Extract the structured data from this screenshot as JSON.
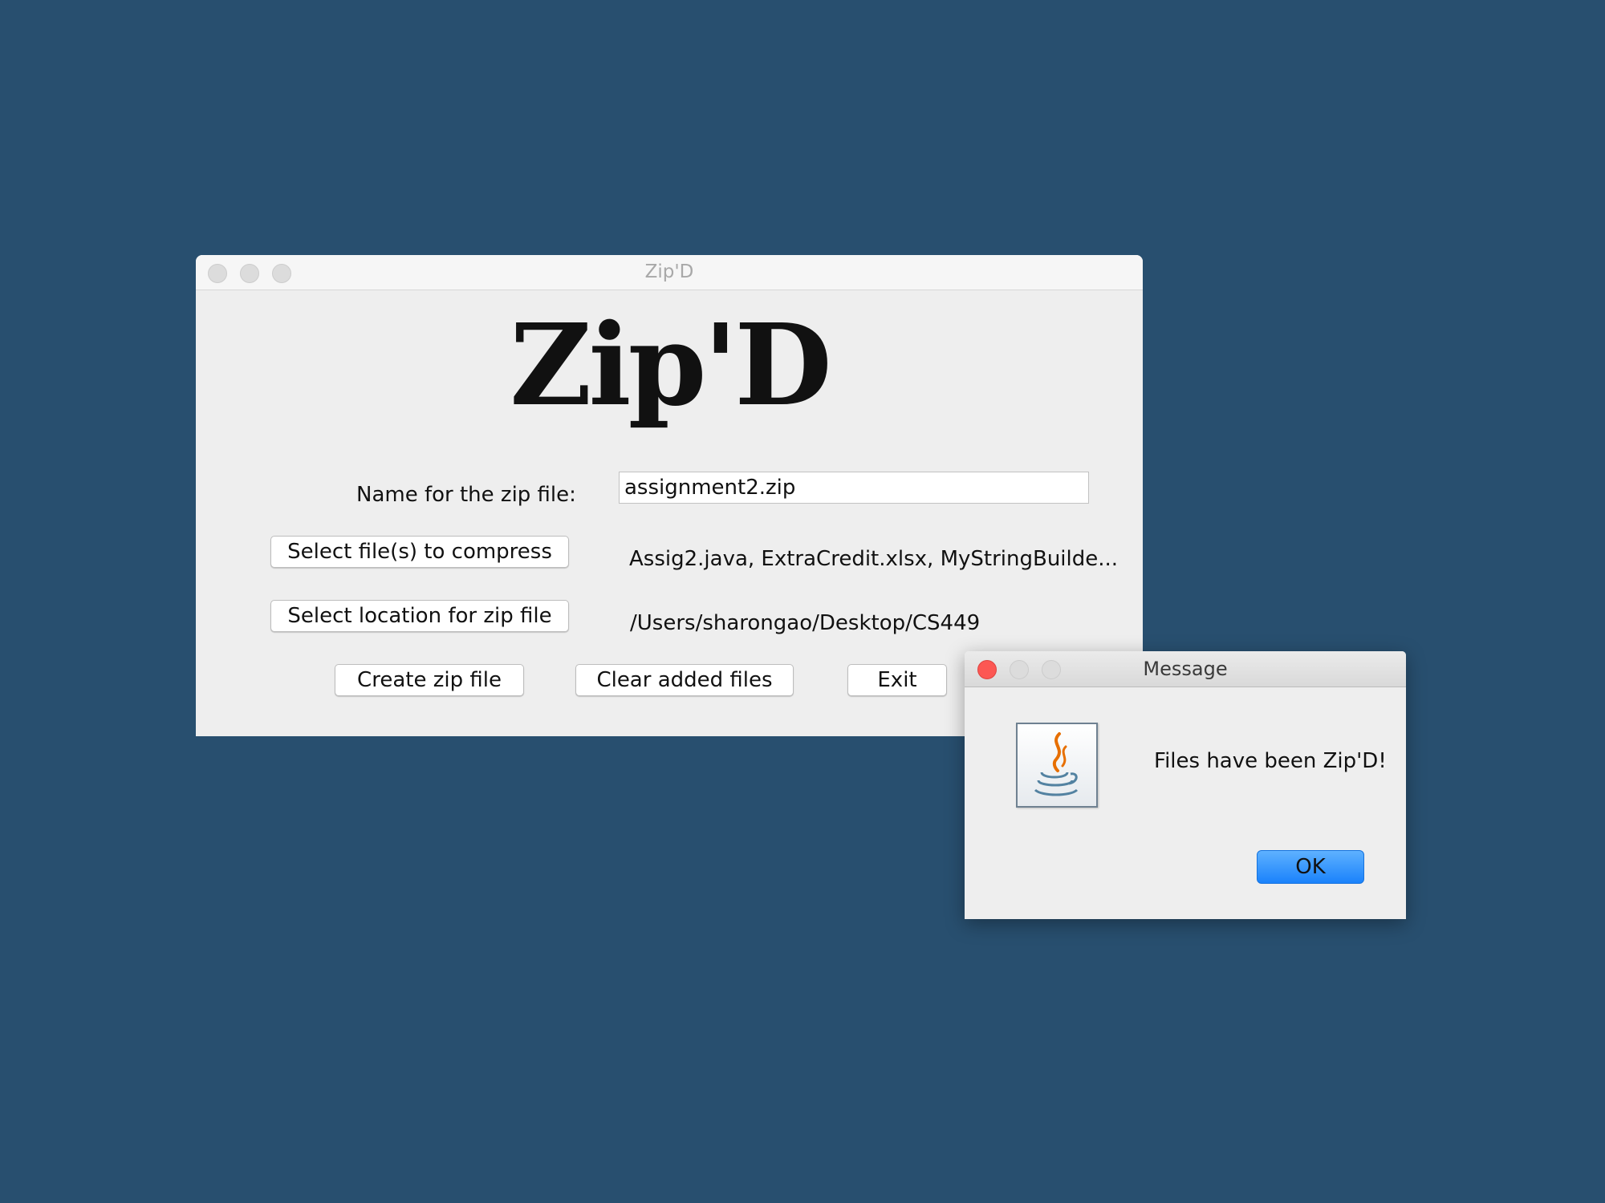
{
  "main_window": {
    "title": "Zip'D",
    "logo": "Zip'D",
    "zip_name_label": "Name for the zip file:",
    "zip_name_value": "assignment2.zip",
    "select_files_button": "Select file(s) to compress",
    "selected_files_text": "Assig2.java, ExtraCredit.xlsx, MyStringBuilde...",
    "select_location_button": "Select location for zip file",
    "location_text": "/Users/sharongao/Desktop/CS449",
    "create_button": "Create zip file",
    "clear_button": "Clear added files",
    "exit_button": "Exit"
  },
  "dialog": {
    "title": "Message",
    "icon": "java-icon",
    "message": "Files have been Zip'D!",
    "ok_button": "OK"
  },
  "colors": {
    "desktop": "#284f6f",
    "window": "#eeeeee",
    "ok_button": "#1a82fb",
    "close_button": "#fc5753"
  }
}
